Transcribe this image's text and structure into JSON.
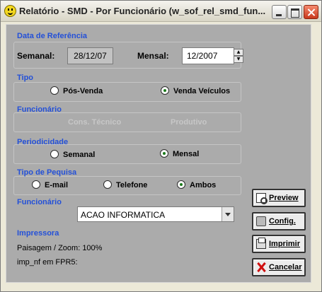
{
  "window": {
    "title": "Relatório - SMD - Por Funcionário (w_sof_rel_smd_fun..."
  },
  "data_referencia": {
    "label": "Data de Referência",
    "semanal_label": "Semanal:",
    "semanal_value": "28/12/07",
    "mensal_label": "Mensal:",
    "mensal_value": "12/2007"
  },
  "tipo": {
    "label": "Tipo",
    "options": [
      "Pós-Venda",
      "Venda Veículos"
    ],
    "selected": "Venda Veículos"
  },
  "funcionario_group": {
    "label": "Funcionário",
    "options": [
      "Cons. Técnico",
      "Produtivo"
    ]
  },
  "periodicidade": {
    "label": "Periodicidade",
    "options": [
      "Semanal",
      "Mensal"
    ],
    "selected": "Mensal"
  },
  "tipo_pesquisa": {
    "label": "Tipo de Pequisa",
    "options": [
      "E-mail",
      "Telefone",
      "Ambos"
    ],
    "selected": "Ambos"
  },
  "funcionario_select": {
    "label": "Funcionário",
    "value": "ACAO INFORMATICA"
  },
  "impressora": {
    "label": "Impressora",
    "zoom_text": "Paisagem / Zoom: 100%",
    "printer_text": "imp_nf em FPR5:"
  },
  "buttons": {
    "preview": "Preview",
    "config": "Config.",
    "imprimir": "Imprimir",
    "cancelar": "Cancelar"
  },
  "colors": {
    "group_label": "#2350d8",
    "panel": "#ababab",
    "dialog": "#ece9d8"
  },
  "icons": {
    "preview": "magnifier-page-icon",
    "config": "printer-config-icon",
    "imprimir": "printer-icon",
    "cancelar": "red-x-icon"
  }
}
